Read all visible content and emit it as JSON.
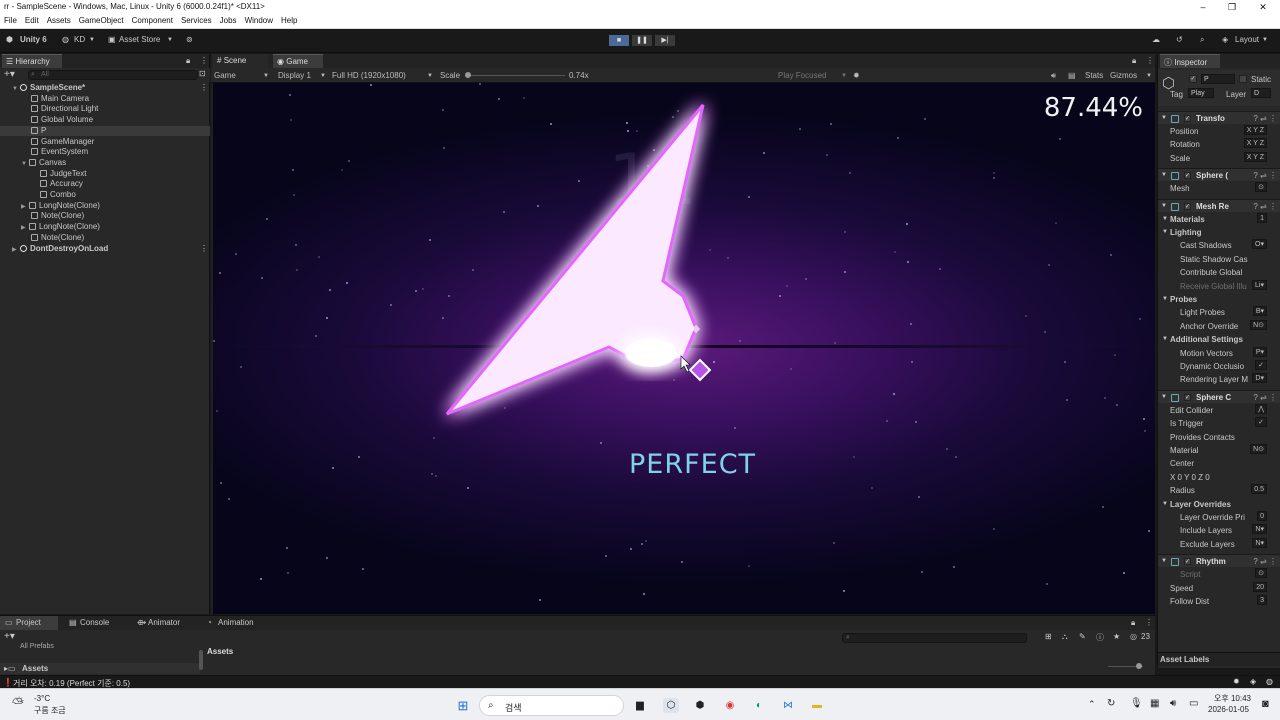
{
  "window": {
    "title": "rr - SampleScene - Windows, Mac, Linux - Unity 6 (6000.0.24f1)* <DX11>",
    "controls": [
      "–",
      "❐",
      "✕"
    ]
  },
  "menu": [
    "File",
    "Edit",
    "Assets",
    "GameObject",
    "Component",
    "Services",
    "Jobs",
    "Window",
    "Help"
  ],
  "toolbar": {
    "unity_label": "Unity 6",
    "account": "KD",
    "asset_store": "Asset Store",
    "layout": "Layout"
  },
  "hierarchy": {
    "tab": "Hierarchy",
    "search_placeholder": "All",
    "items": [
      {
        "label": "SampleScene*",
        "depth": 0,
        "kind": "scene"
      },
      {
        "label": "Main Camera",
        "depth": 1
      },
      {
        "label": "Directional Light",
        "depth": 1
      },
      {
        "label": "Global Volume",
        "depth": 1
      },
      {
        "label": "P",
        "depth": 1,
        "selected": true
      },
      {
        "label": "GameManager",
        "depth": 1
      },
      {
        "label": "EventSystem",
        "depth": 1
      },
      {
        "label": "Canvas",
        "depth": 1,
        "expanded": true
      },
      {
        "label": "JudgeText",
        "depth": 2
      },
      {
        "label": "Accuracy",
        "depth": 2
      },
      {
        "label": "Combo",
        "depth": 2
      },
      {
        "label": "LongNote(Clone)",
        "depth": 1,
        "collapsed": true
      },
      {
        "label": "Note(Clone)",
        "depth": 1
      },
      {
        "label": "LongNote(Clone)",
        "depth": 1,
        "collapsed": true
      },
      {
        "label": "Note(Clone)",
        "depth": 1
      },
      {
        "label": "DontDestroyOnLoad",
        "depth": 0,
        "kind": "scene"
      }
    ]
  },
  "game": {
    "tabs": [
      "Scene",
      "Game"
    ],
    "active_tab": "Game",
    "mode": "Game",
    "display": "Display 1",
    "resolution": "Full HD (1920x1080)",
    "scale_label": "Scale",
    "scale_value": "0.74x",
    "play_focused": "Play Focused",
    "stats": "Stats",
    "gizmos": "Gizmos",
    "accuracy": "87.44%",
    "judge": "PERFECT",
    "combo_ghost": "11"
  },
  "inspector": {
    "tab": "Inspector",
    "object_name": "P",
    "static_label": "Static",
    "tag_label": "Tag",
    "tag_value": "Play",
    "layer_label": "Layer",
    "layer_value": "D",
    "rows": [
      {
        "kind": "sec",
        "label": "Transfo"
      },
      {
        "kind": "sub",
        "label": "Position",
        "value": "X Y Z"
      },
      {
        "kind": "sub",
        "label": "Rotation",
        "value": "X Y Z"
      },
      {
        "kind": "sub",
        "label": "Scale",
        "value": "X Y Z"
      },
      {
        "kind": "sec",
        "label": "Sphere ("
      },
      {
        "kind": "sub",
        "label": "Mesh",
        "value": "⊙"
      },
      {
        "kind": "sec",
        "label": "Mesh Re"
      },
      {
        "kind": "grp",
        "label": "Materials",
        "value": "1"
      },
      {
        "kind": "grp",
        "label": "Lighting"
      },
      {
        "kind": "sub2",
        "label": "Cast Shadows",
        "value": "O▾"
      },
      {
        "kind": "sub2",
        "label": "Static Shadow Cas"
      },
      {
        "kind": "sub2",
        "label": "Contribute Global"
      },
      {
        "kind": "dim",
        "label": "Receive Global Illu",
        "value": "Li▾"
      },
      {
        "kind": "grp",
        "label": "Probes"
      },
      {
        "kind": "sub2",
        "label": "Light Probes",
        "value": "B▾"
      },
      {
        "kind": "sub2",
        "label": "Anchor Override",
        "value": "N⊙"
      },
      {
        "kind": "grp",
        "label": "Additional Settings"
      },
      {
        "kind": "sub2",
        "label": "Motion Vectors",
        "value": "P▾"
      },
      {
        "kind": "sub2",
        "label": "Dynamic Occlusio",
        "value": "✓"
      },
      {
        "kind": "sub2",
        "label": "Rendering Layer M",
        "value": "D▾"
      },
      {
        "kind": "sec",
        "label": "Sphere C"
      },
      {
        "kind": "sub",
        "label": "Edit Collider",
        "value": "⋀"
      },
      {
        "kind": "sub",
        "label": "Is Trigger",
        "value": "✓"
      },
      {
        "kind": "sub",
        "label": "Provides Contacts"
      },
      {
        "kind": "sub",
        "label": "Material",
        "value": "N⊙"
      },
      {
        "kind": "sub",
        "label": "Center"
      },
      {
        "kind": "sub",
        "label": "X 0   Y 0   Z 0"
      },
      {
        "kind": "sub",
        "label": "Radius",
        "value": "0.5"
      },
      {
        "kind": "grp",
        "label": "Layer Overrides"
      },
      {
        "kind": "sub2",
        "label": "Layer Override Pri",
        "value": "0"
      },
      {
        "kind": "sub2",
        "label": "Include Layers",
        "value": "N▾"
      },
      {
        "kind": "sub2",
        "label": "Exclude Layers",
        "value": "N▾"
      },
      {
        "kind": "sec",
        "label": "Rhythm"
      },
      {
        "kind": "dim",
        "label": "Script",
        "value": "⊙"
      },
      {
        "kind": "sub",
        "label": "Speed",
        "value": "20"
      },
      {
        "kind": "sub",
        "label": "Follow Dist",
        "value": "3"
      }
    ],
    "asset_labels": "Asset Labels"
  },
  "project": {
    "tabs": [
      "Project",
      "Console",
      "Animator",
      "Animation"
    ],
    "favorites_item": "All Prefabs",
    "assets_label": "Assets",
    "breadcrumb": "Assets",
    "count": "23"
  },
  "status": {
    "message": "거리 오차: 0.19 (Perfect 기준: 0.5)"
  },
  "taskbar": {
    "weather_temp": "-3°C",
    "weather_desc": "구름 조금",
    "search": "검색",
    "time": "오후 10:43",
    "date": "2026-01-05"
  }
}
